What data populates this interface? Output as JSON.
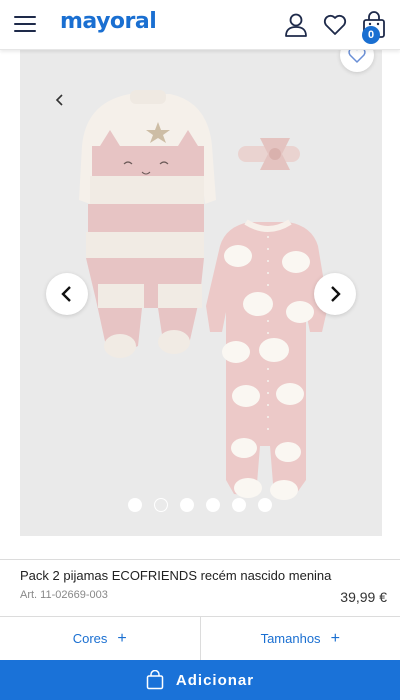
{
  "header": {
    "logo_text": "mayoral",
    "icons": [
      "menu-icon",
      "user-icon",
      "heart-icon",
      "shopping-bag-icon"
    ],
    "bag_count": "0"
  },
  "gallery": {
    "slide_count": 6,
    "active_slide": 2,
    "icons": [
      "chevron-left-icon",
      "chevron-right-icon",
      "heart-icon"
    ]
  },
  "product": {
    "name": "Pack 2 pijamas ECOFRIENDS recém nascido menina",
    "ref": "Art. 11-02669-003",
    "price": "39,99 €"
  },
  "options": {
    "colors_label": "Cores",
    "sizes_label": "Tamanhos"
  },
  "cta": {
    "add_label": "Adicionar"
  },
  "colors": {
    "accent": "#1a72d8",
    "logo": "#1a6fd1",
    "gallery_bg": "#eaeaea",
    "pink": "#e7c4c4"
  }
}
